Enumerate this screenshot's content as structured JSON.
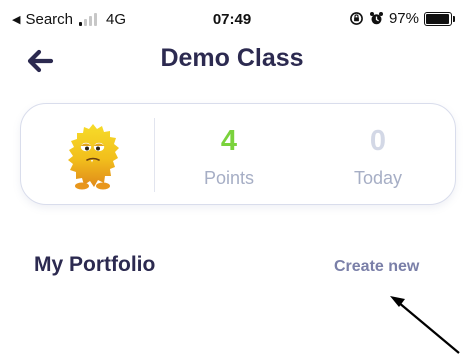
{
  "status_bar": {
    "carrier": "Search",
    "network": "4G",
    "time": "07:49",
    "battery_percent": "97%",
    "signal_bars_active": 1,
    "signal_bars_total": 4
  },
  "header": {
    "title": "Demo Class"
  },
  "stats": {
    "points_value": "4",
    "points_label": "Points",
    "today_value": "0",
    "today_label": "Today"
  },
  "portfolio": {
    "title": "My Portfolio",
    "create_label": "Create new"
  },
  "colors": {
    "title_text": "#2c2a50",
    "points_green": "#7ad23c",
    "today_grey": "#d3d8e6",
    "label_grey": "#a6aec5",
    "link_grey": "#7a7fa8",
    "card_border": "#d9ddec",
    "avatar_yellow": "#f3c81e",
    "avatar_orange": "#e49a1e"
  },
  "icons": {
    "back": "left-arrow-icon",
    "avatar": "yellow-monster-avatar",
    "status_back": "small-back-triangle-icon",
    "orientation_lock": "orientation-lock-icon",
    "alarm": "alarm-clock-icon",
    "battery": "battery-icon"
  }
}
